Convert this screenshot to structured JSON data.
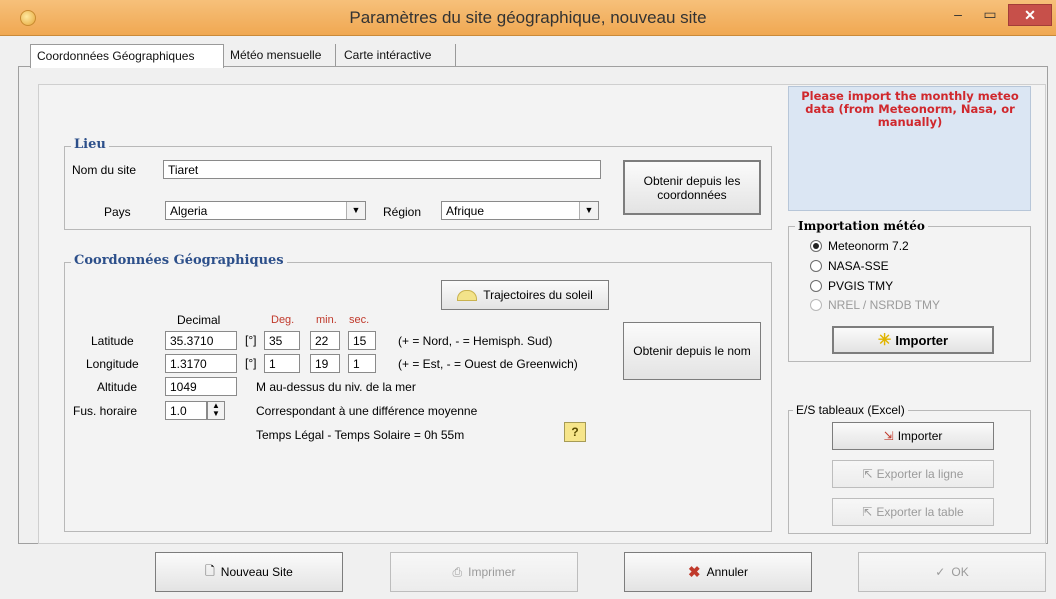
{
  "window": {
    "title": "Paramètres du site géographique, nouveau site"
  },
  "tabs": [
    "Coordonnées Géographiques",
    "Météo mensuelle",
    "Carte intéractive"
  ],
  "lieu": {
    "legend": "Lieu",
    "site_label": "Nom du site",
    "site_value": "Tiaret",
    "country_label": "Pays",
    "country_value": "Algeria",
    "region_label": "Région",
    "region_value": "Afrique",
    "from_coords_button": "Obtenir depuis les coordonnées"
  },
  "coords": {
    "legend": "Coordonnées Géographiques",
    "sun_paths_button": "Trajectoires du soleil",
    "col_decimal": "Decimal",
    "col_deg": "Deg.",
    "col_min": "min.",
    "col_sec": "sec.",
    "lat_label": "Latitude",
    "lat_decimal": "35.3710",
    "lat_unit": "[°]",
    "lat_deg": "35",
    "lat_min": "22",
    "lat_sec": "15",
    "lat_hint": "(+ = Nord, - = Hemisph. Sud)",
    "lon_label": "Longitude",
    "lon_decimal": "1.3170",
    "lon_unit": "[°]",
    "lon_deg": "1",
    "lon_min": "19",
    "lon_sec": "1",
    "lon_hint": "(+ = Est, - = Ouest de Greenwich)",
    "alt_label": "Altitude",
    "alt_value": "1049",
    "alt_hint": "M au-dessus du niv. de la mer",
    "tz_label": "Fus. horaire",
    "tz_value": "1.0",
    "tz_hint": "Correspondant à une différence moyenne",
    "legal_solar": "Temps Légal - Temps Solaire =  0h 55m",
    "help_label": "?",
    "from_name_button": "Obtenir depuis le nom"
  },
  "info": {
    "message": "Please import the monthly meteo data (from Meteonorm, Nasa, or manually)"
  },
  "meteo_import": {
    "legend": "Importation météo",
    "options": [
      {
        "label": "Meteonorm 7.2",
        "selected": true,
        "enabled": true
      },
      {
        "label": "NASA-SSE",
        "selected": false,
        "enabled": true
      },
      {
        "label": "PVGIS TMY",
        "selected": false,
        "enabled": true
      },
      {
        "label": "NREL / NSRDB TMY",
        "selected": false,
        "enabled": false
      }
    ],
    "import_button": "Importer"
  },
  "excel": {
    "legend": "E/S tableaux (Excel)",
    "import_button": "Importer",
    "export_row_button": "Exporter la ligne",
    "export_table_button": "Exporter la table"
  },
  "footer": {
    "new_site": "Nouveau Site",
    "print": "Imprimer",
    "cancel": "Annuler",
    "ok": "OK"
  },
  "colors": {
    "info_text": "#d0282d",
    "legend_blue": "#2c4f8a",
    "deg_red": "#c0392b",
    "titlebar": "#f0a852"
  }
}
